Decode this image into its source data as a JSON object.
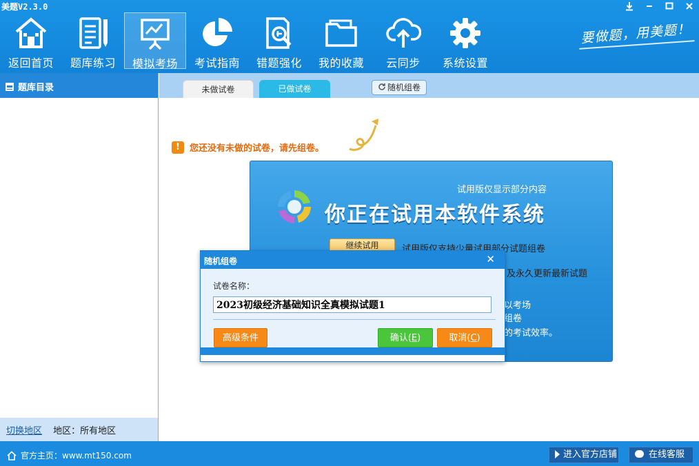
{
  "app": {
    "title": "美题V2.3.0"
  },
  "window_controls": [
    "download-icon",
    "minimize-icon",
    "maximize-icon",
    "close-icon"
  ],
  "nav": {
    "items": [
      {
        "label": "返回首页",
        "icon": "home-icon"
      },
      {
        "label": "题库练习",
        "icon": "notebook-pencil-icon"
      },
      {
        "label": "模拟考场",
        "icon": "presentation-board-icon",
        "active": true
      },
      {
        "label": "考试指南",
        "icon": "pie-chart-icon"
      },
      {
        "label": "错题强化",
        "icon": "search-document-icon"
      },
      {
        "label": "我的收藏",
        "icon": "folder-icon"
      },
      {
        "label": "云同步",
        "icon": "cloud-upload-icon"
      },
      {
        "label": "系统设置",
        "icon": "gear-icon"
      }
    ],
    "slogan": "要做题，用美题！"
  },
  "sidebar": {
    "title": "题库目录",
    "switch_region": "切换地区",
    "region": "地区：所有地区"
  },
  "tabs": {
    "undone": "未做试卷",
    "done": "已做试卷",
    "random": "随机组卷"
  },
  "content": {
    "warning": "您还没有未做的试卷，请先组卷。"
  },
  "trial": {
    "subtitle": "试用版仅显示部分内容",
    "title": "你正在试用本软件系统",
    "continue_button": "继续试用",
    "line1": "试用版仅支持少量试用部分试题组卷",
    "line2": "及永久更新最新试题",
    "line3": "以考场",
    "line4": "组卷",
    "line5": "的考试效率。"
  },
  "dialog": {
    "title": "随机组卷",
    "name_label": "试卷名称：",
    "name_value": "2023初级经济基础知识全真模拟试题1",
    "advanced_button": "高级条件",
    "ok_label": "确认(",
    "ok_key": "E",
    "ok_end": ")",
    "cancel_label": "取消(",
    "cancel_key": "C",
    "cancel_end": ")"
  },
  "statusbar": {
    "homepage": "官方主页：www.mt150.com",
    "shop_button": "进入官方店铺",
    "service_button": "在线客服"
  },
  "colors": {
    "primary": "#1283d8",
    "accent_orange": "#f78a16",
    "accent_green": "#4bc63c",
    "warning_text": "#e26b0f"
  }
}
